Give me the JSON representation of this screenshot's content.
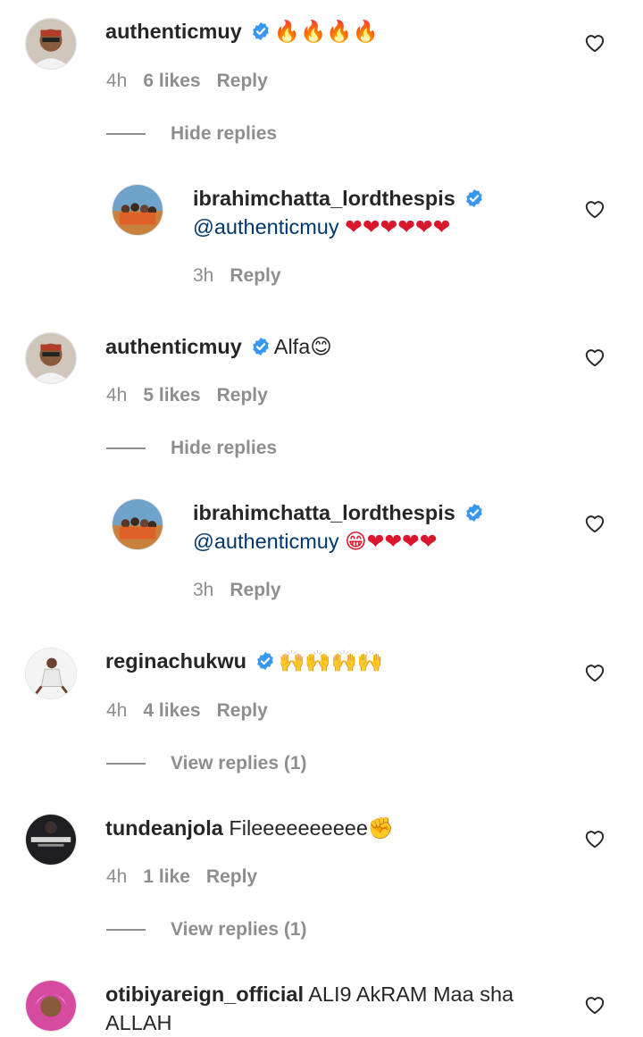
{
  "comments": [
    {
      "username": "authenticmuy",
      "text": "🔥🔥🔥🔥",
      "time": "4h",
      "likes": "6 likes",
      "reply": "Reply",
      "toggle": "Hide replies"
    },
    {
      "username": "ibrahimchatta_lordthespis",
      "mention": "@authenticmuy",
      "text": "❤❤❤❤❤❤",
      "time": "3h",
      "reply": "Reply"
    },
    {
      "username": "authenticmuy",
      "text": "Alfa😊",
      "time": "4h",
      "likes": "5 likes",
      "reply": "Reply",
      "toggle": "Hide replies"
    },
    {
      "username": "ibrahimchatta_lordthespis",
      "mention": "@authenticmuy",
      "text": "😁❤❤❤❤",
      "time": "3h",
      "reply": "Reply"
    },
    {
      "username": "reginachukwu",
      "text": "🙌🙌🙌🙌",
      "time": "4h",
      "likes": "4 likes",
      "reply": "Reply",
      "toggle": "View replies (1)"
    },
    {
      "username": "tundeanjola",
      "text": "Fileeeeeeeeee✊",
      "time": "4h",
      "likes": "1 like",
      "reply": "Reply",
      "toggle": "View replies (1)"
    },
    {
      "username": "otibiyareign_official",
      "text": "ALI9 AkRAM Maa sha ALLAH"
    }
  ],
  "icons": {
    "verified": "verified-badge-icon",
    "like": "heart-outline-icon"
  },
  "colors": {
    "verified": "#3897f0",
    "mention": "#00376b",
    "meta": "#8e8e8e"
  }
}
